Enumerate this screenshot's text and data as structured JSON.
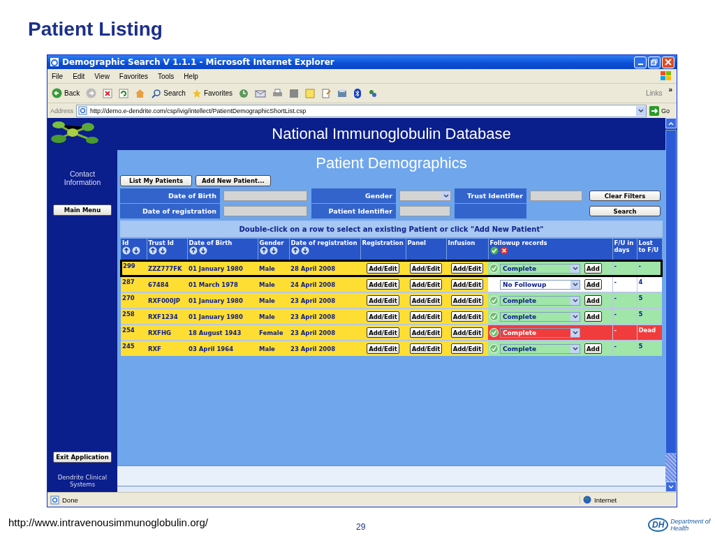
{
  "slide": {
    "title": "Patient Listing",
    "footer_url": "http://www.intravenousimmunoglobulin.org/",
    "page_number": "29",
    "logo_mark": "DH",
    "logo_caption": "Department of Health"
  },
  "window": {
    "title": "Demographic Search V 1.1.1 - Microsoft Internet Explorer"
  },
  "menu": [
    "File",
    "Edit",
    "View",
    "Favorites",
    "Tools",
    "Help"
  ],
  "toolbar": {
    "back": "Back",
    "search": "Search",
    "favorites": "Favorites",
    "links": "Links",
    "more": "»"
  },
  "address": {
    "label": "Address",
    "url": "http://demo.e-dendrite.com/csp/ivig/intellect/PatientDemographicShortList.csp",
    "go": "Go"
  },
  "app": {
    "header": "National Immunoglobulin Database",
    "contact": "Contact Information",
    "main_menu": "Main Menu",
    "exit": "Exit Application",
    "company": "Dendrite Clinical Systems",
    "page_title": "Patient Demographics",
    "buttons": [
      "List My Patients",
      "Add New Patient..."
    ],
    "filters": [
      {
        "label": "Date of Birth",
        "kind": "text"
      },
      {
        "label": "Gender",
        "kind": "select"
      },
      {
        "label": "Trust Identifier",
        "kind": "text"
      },
      {
        "label": "Date of registration",
        "kind": "text"
      },
      {
        "label": "Patient Identifier",
        "kind": "text"
      }
    ],
    "clear_filters": "Clear Filters",
    "search": "Search",
    "hint": "Double-click on a row to select an existing Patient or click \"Add New Patient\""
  },
  "table": {
    "columns": [
      {
        "label": "Id",
        "sortable": true
      },
      {
        "label": "Trust Id",
        "sortable": true
      },
      {
        "label": "Date of Birth",
        "sortable": true
      },
      {
        "label": "Gender",
        "sortable": true
      },
      {
        "label": "Date of registration",
        "sortable": true
      },
      {
        "label": "Registration",
        "sortable": false
      },
      {
        "label": "Panel",
        "sortable": false
      },
      {
        "label": "Infusion",
        "sortable": false
      },
      {
        "label": "Followup records",
        "sortable": false,
        "filter_icons": true
      },
      {
        "label": "F/U in days",
        "sortable": false
      },
      {
        "label": "Lost to F/U",
        "sortable": false
      }
    ],
    "rows": [
      {
        "id": "299",
        "trust_id": "ZZZ777FK",
        "dob": "01 January 1980",
        "gender": "Male",
        "reg_date": "28 April 2008",
        "registration": "Add/Edit",
        "panel": "Add/Edit",
        "infusion": "Add/Edit",
        "kind": "complete",
        "followup": "Complete",
        "add": "Add",
        "fu_days": "-",
        "lost": "-",
        "selected": true
      },
      {
        "id": "287",
        "trust_id": "67484",
        "dob": "01 March 1978",
        "gender": "Male",
        "reg_date": "24 April 2008",
        "registration": "Add/Edit",
        "panel": "Add/Edit",
        "infusion": "Add/Edit",
        "kind": "none",
        "followup": "No Followup",
        "add": "Add",
        "fu_days": "-",
        "lost": "4",
        "selected": false
      },
      {
        "id": "270",
        "trust_id": "RXF000JP",
        "dob": "01 January 1980",
        "gender": "Male",
        "reg_date": "23 April 2008",
        "registration": "Add/Edit",
        "panel": "Add/Edit",
        "infusion": "Add/Edit",
        "kind": "complete",
        "followup": "Complete",
        "add": "Add",
        "fu_days": "-",
        "lost": "5",
        "selected": false
      },
      {
        "id": "258",
        "trust_id": "RXF1234",
        "dob": "01 January 1980",
        "gender": "Male",
        "reg_date": "23 April 2008",
        "registration": "Add/Edit",
        "panel": "Add/Edit",
        "infusion": "Add/Edit",
        "kind": "complete",
        "followup": "Complete",
        "add": "Add",
        "fu_days": "-",
        "lost": "5",
        "selected": false
      },
      {
        "id": "254",
        "trust_id": "RXFHG",
        "dob": "18 August 1943",
        "gender": "Female",
        "reg_date": "23 April 2008",
        "registration": "Add/Edit",
        "panel": "Add/Edit",
        "infusion": "Add/Edit",
        "kind": "dead",
        "followup": "Complete",
        "fu_days": "-",
        "lost": "Dead",
        "selected": false
      },
      {
        "id": "245",
        "trust_id": "RXF",
        "dob": "03 April 1964",
        "gender": "Male",
        "reg_date": "23 April 2008",
        "registration": "Add/Edit",
        "panel": "Add/Edit",
        "infusion": "Add/Edit",
        "kind": "complete",
        "followup": "Complete",
        "add": "Add",
        "fu_days": "-",
        "lost": "5",
        "selected": false
      }
    ]
  },
  "status_bar": {
    "text": "Done",
    "zone": "Internet"
  }
}
